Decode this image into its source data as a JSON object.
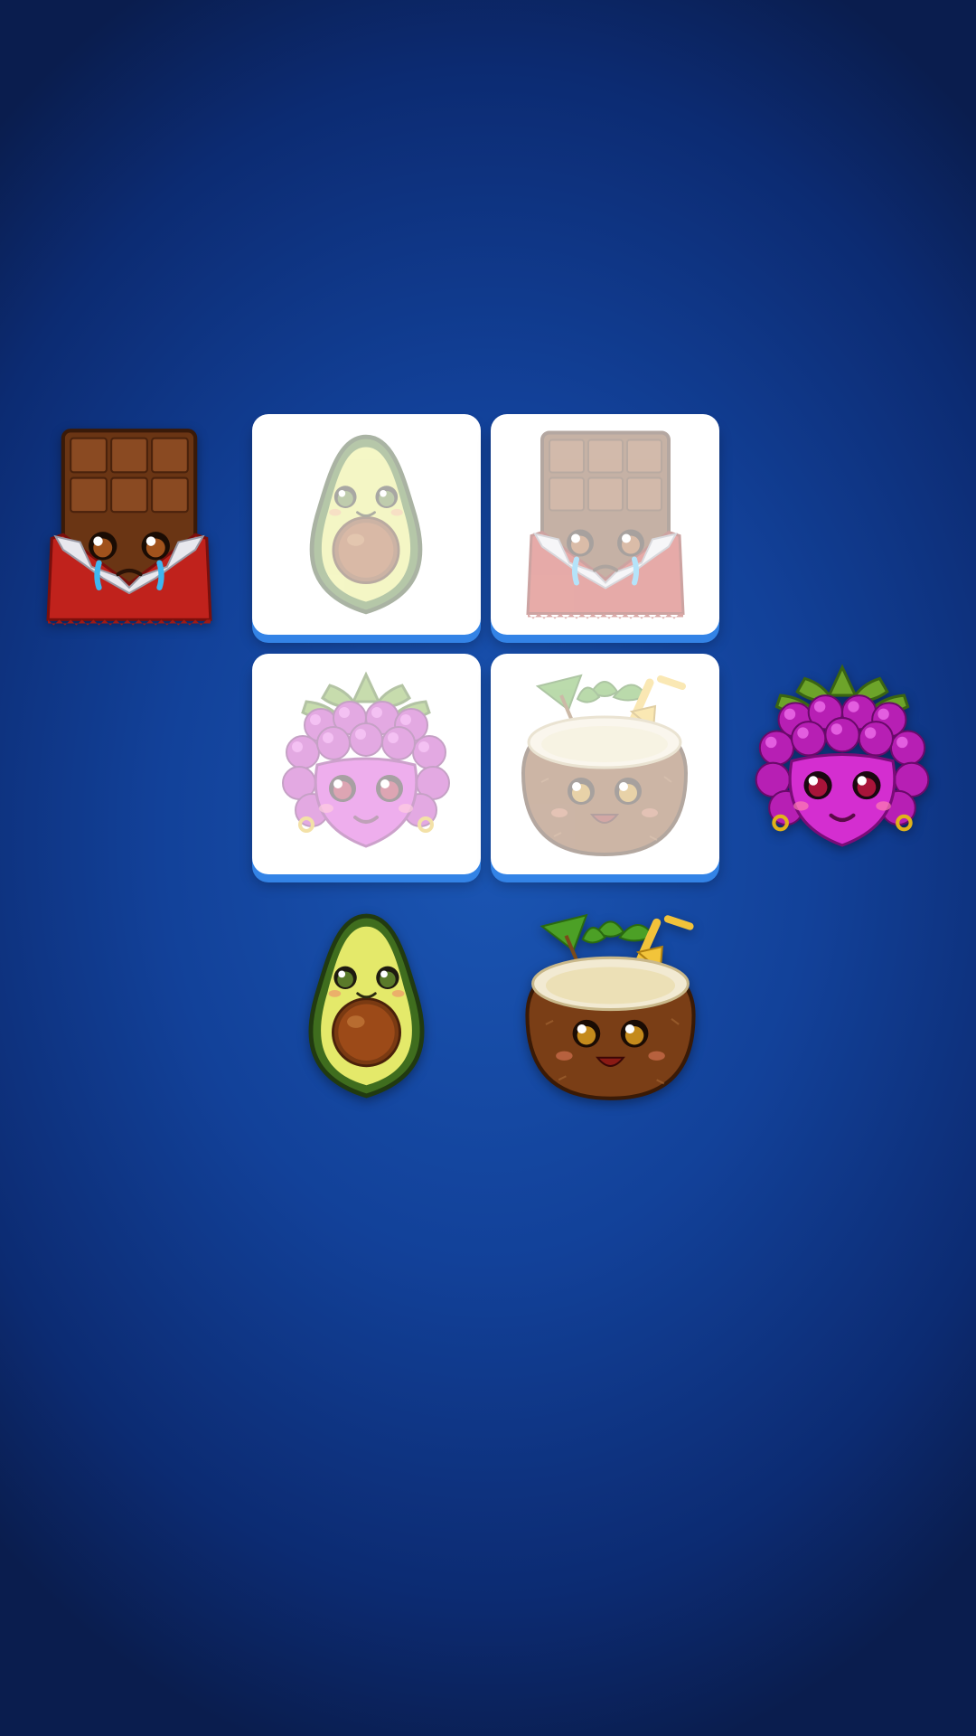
{
  "game": {
    "board": {
      "slots": [
        {
          "id": "slot-avatar-avocado",
          "icon": "avocado-icon",
          "state": "empty-hint"
        },
        {
          "id": "slot-chocolate",
          "icon": "chocolate-bar-icon",
          "state": "empty-hint"
        },
        {
          "id": "slot-raspberry",
          "icon": "raspberry-icon",
          "state": "empty-hint"
        },
        {
          "id": "slot-coconut",
          "icon": "coconut-drink-icon",
          "state": "empty-hint"
        }
      ]
    },
    "pieces": [
      {
        "icon": "chocolate-bar-icon",
        "mood": "crying"
      },
      {
        "icon": "raspberry-icon",
        "mood": "smiling"
      },
      {
        "icon": "avocado-icon",
        "mood": "smiling"
      },
      {
        "icon": "coconut-drink-icon",
        "mood": "happy"
      }
    ],
    "colors": {
      "slot_fill": "#ffffff",
      "slot_edge": "#3383e6",
      "background_center": "#1b56b4",
      "background_edge": "#0a1d4e"
    }
  }
}
